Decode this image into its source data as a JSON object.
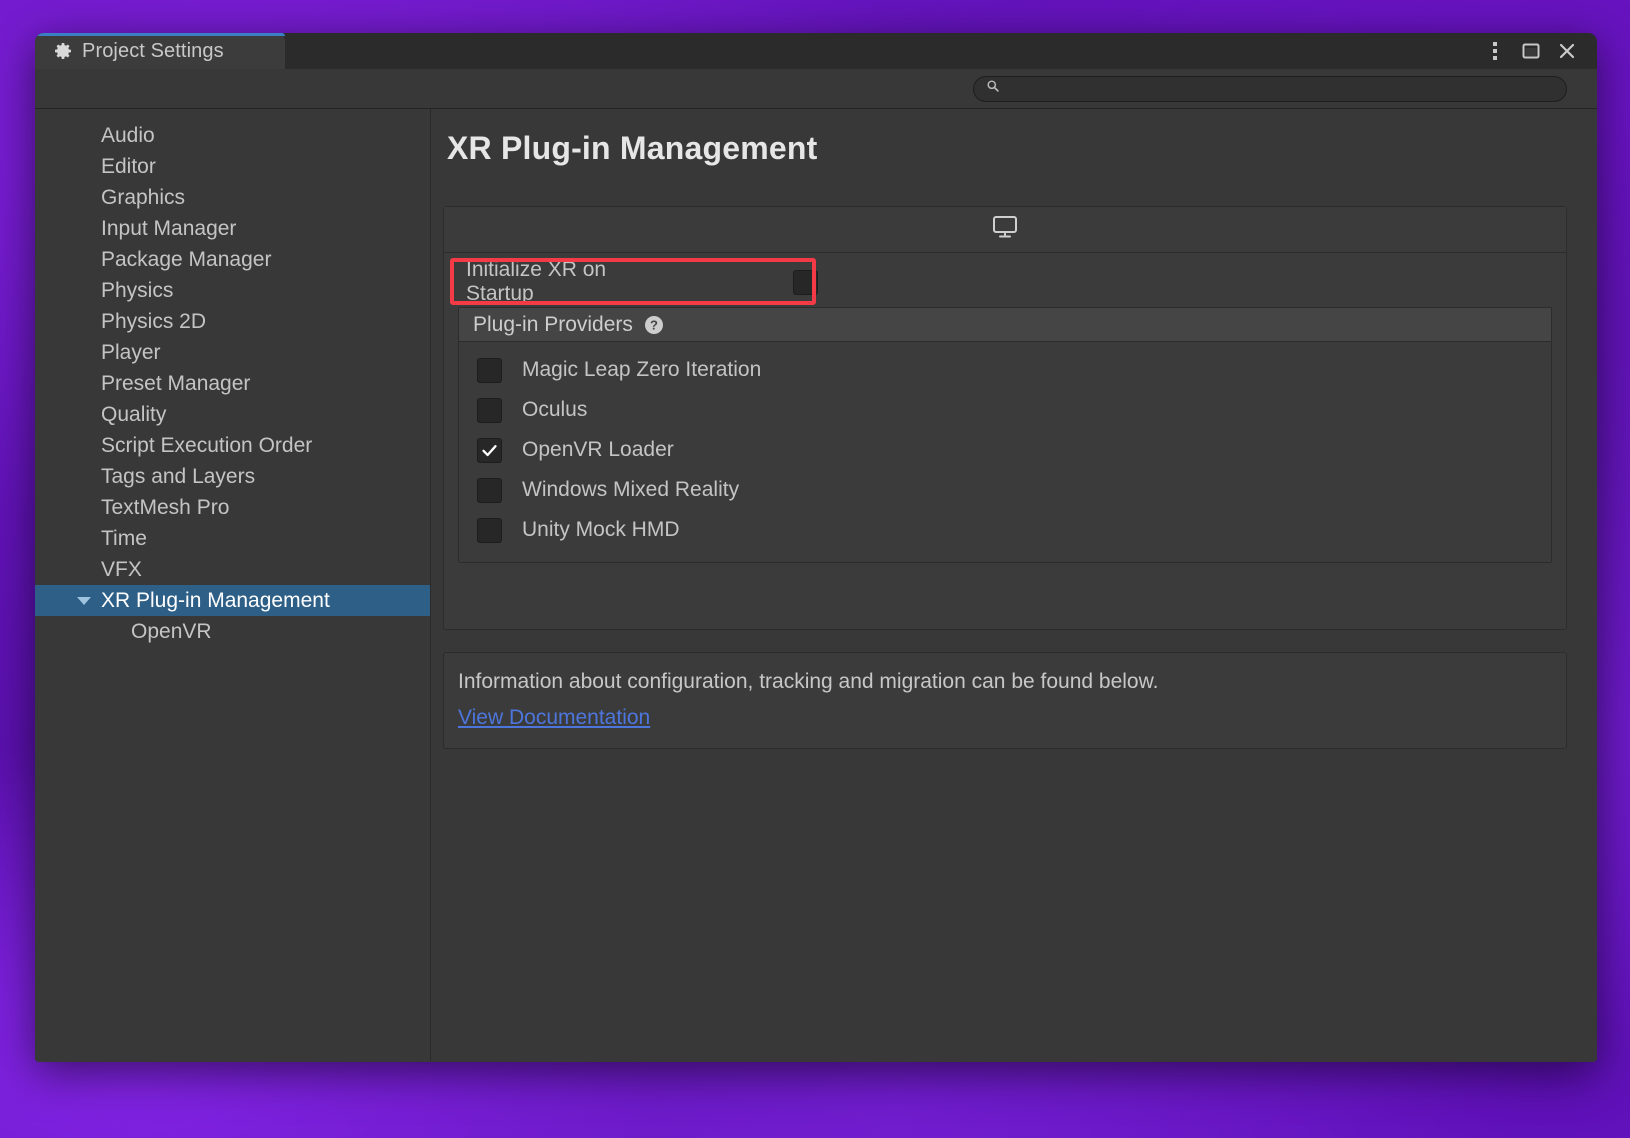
{
  "window": {
    "tab_label": "Project Settings",
    "tab_icon": "gear-icon",
    "controls": {
      "menu": "kebab-menu-icon",
      "maximize": "maximize-icon",
      "close": "close-icon"
    }
  },
  "search": {
    "value": "",
    "placeholder": "",
    "icon": "search-icon"
  },
  "sidebar": {
    "items": [
      {
        "label": "Audio",
        "selected": false,
        "child": false,
        "expandable": false
      },
      {
        "label": "Editor",
        "selected": false,
        "child": false,
        "expandable": false
      },
      {
        "label": "Graphics",
        "selected": false,
        "child": false,
        "expandable": false
      },
      {
        "label": "Input Manager",
        "selected": false,
        "child": false,
        "expandable": false
      },
      {
        "label": "Package Manager",
        "selected": false,
        "child": false,
        "expandable": false
      },
      {
        "label": "Physics",
        "selected": false,
        "child": false,
        "expandable": false
      },
      {
        "label": "Physics 2D",
        "selected": false,
        "child": false,
        "expandable": false
      },
      {
        "label": "Player",
        "selected": false,
        "child": false,
        "expandable": false
      },
      {
        "label": "Preset Manager",
        "selected": false,
        "child": false,
        "expandable": false
      },
      {
        "label": "Quality",
        "selected": false,
        "child": false,
        "expandable": false
      },
      {
        "label": "Script Execution Order",
        "selected": false,
        "child": false,
        "expandable": false
      },
      {
        "label": "Tags and Layers",
        "selected": false,
        "child": false,
        "expandable": false
      },
      {
        "label": "TextMesh Pro",
        "selected": false,
        "child": false,
        "expandable": false
      },
      {
        "label": "Time",
        "selected": false,
        "child": false,
        "expandable": false
      },
      {
        "label": "VFX",
        "selected": false,
        "child": false,
        "expandable": false
      },
      {
        "label": "XR Plug-in Management",
        "selected": true,
        "child": false,
        "expandable": true
      },
      {
        "label": "OpenVR",
        "selected": false,
        "child": true,
        "expandable": false
      }
    ]
  },
  "main": {
    "title": "XR Plug-in Management",
    "platform_tabs": [
      {
        "name": "desktop-platform-tab",
        "icon": "monitor-icon",
        "active": true
      }
    ],
    "initialize_row": {
      "label": "Initialize XR on Startup",
      "checked": false,
      "annotated": true,
      "annotation_color": "#f53a47"
    },
    "providers_section": {
      "header": "Plug-in Providers",
      "help_icon": "help-icon",
      "items": [
        {
          "label": "Magic Leap Zero Iteration",
          "checked": false
        },
        {
          "label": "Oculus",
          "checked": false
        },
        {
          "label": "OpenVR Loader",
          "checked": true
        },
        {
          "label": "Windows Mixed Reality",
          "checked": false
        },
        {
          "label": "Unity Mock HMD",
          "checked": false
        }
      ]
    },
    "info": {
      "text": "Information about configuration, tracking and migration can be found below.",
      "link_label": "View Documentation",
      "link_color": "#4d76dd"
    }
  },
  "colors": {
    "window_bg": "#383838",
    "titlebar_bg": "#2b2b2b",
    "tab_active_bg": "#3c3c3c",
    "tab_accent": "#3b7fc4",
    "selection_blue": "#2e5f87",
    "panel_bg": "#3b3b3b",
    "panel_header_bg": "#454545",
    "text": "#c4c4c4",
    "desktop_purple": "#6d17c9"
  }
}
